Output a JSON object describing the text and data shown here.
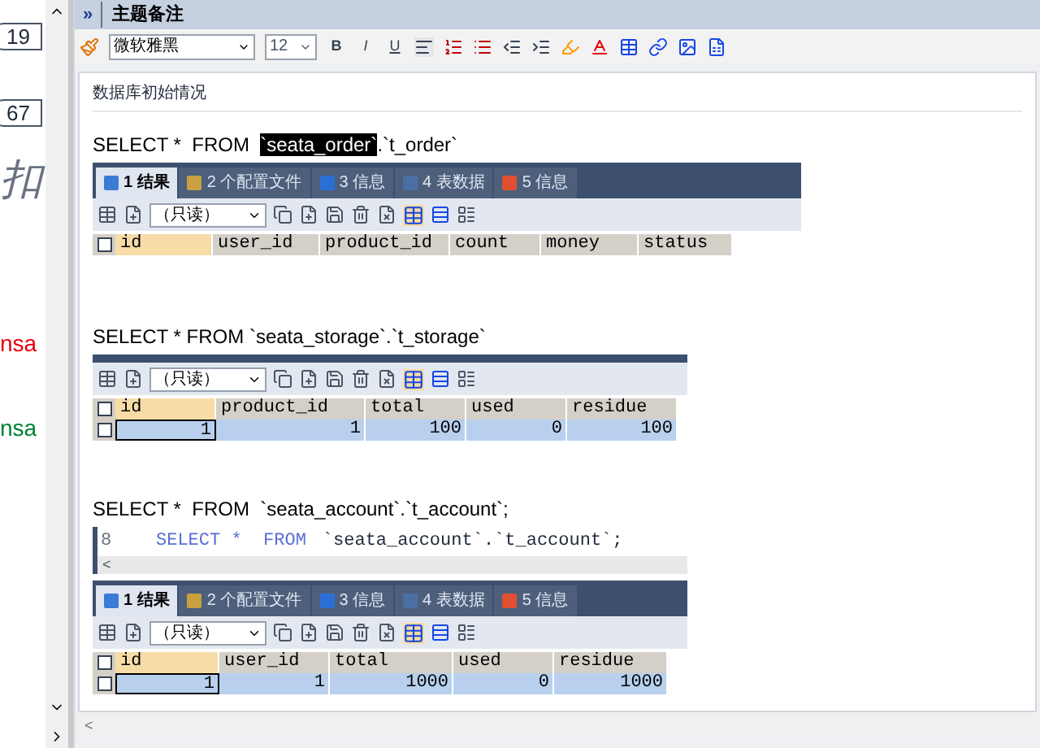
{
  "side_fragments": [
    {
      "kind": "badge",
      "text": "19"
    },
    {
      "kind": "badge",
      "text": "67"
    },
    {
      "kind": "glyph",
      "text": "扣"
    },
    {
      "kind": "red",
      "text": "nsa"
    },
    {
      "kind": "green",
      "text": "nsa"
    }
  ],
  "header": {
    "toggle": "»",
    "title": "主题备注"
  },
  "toolbar": {
    "font": "微软雅黑",
    "size": "12",
    "bold": "B",
    "italic": "I",
    "underline": "U"
  },
  "note_title": "数据库初始情况",
  "blocks": [
    {
      "query": [
        {
          "text": "SELECT *  FROM  ",
          "selected": false
        },
        {
          "text": "`seata_order`",
          "selected": true
        },
        {
          "text": ".`t_order`",
          "selected": false
        }
      ],
      "tabs": [
        {
          "label": "1 结果",
          "selected": true
        },
        {
          "label": "2 个配置文件",
          "selected": false
        },
        {
          "label": "3 信息",
          "selected": false
        },
        {
          "label": "4 表数据",
          "selected": false
        },
        {
          "label": "5 信息",
          "selected": false
        }
      ],
      "mode": "（只读）",
      "columns": [
        {
          "label": "id",
          "selected": true
        },
        {
          "label": "user_id",
          "selected": false
        },
        {
          "label": "product_id",
          "selected": false
        },
        {
          "label": "count",
          "selected": false
        },
        {
          "label": "money",
          "selected": false
        },
        {
          "label": "status",
          "selected": false
        }
      ],
      "select_all_checked": false
    },
    {
      "query": [
        {
          "text": "SELECT * FROM `seata_storage`.`t_storage`",
          "selected": false
        }
      ],
      "mode": "（只读）",
      "columns": [
        {
          "label": "id",
          "selected": true
        },
        {
          "label": "product_id",
          "selected": false
        },
        {
          "label": "total",
          "selected": false
        },
        {
          "label": "used",
          "selected": false
        },
        {
          "label": "residue",
          "selected": false
        }
      ],
      "select_all_checked": false,
      "rows": [
        {
          "checked": false,
          "cells": [
            "1",
            "1",
            "100",
            "0",
            "100"
          ]
        }
      ]
    },
    {
      "query": [
        {
          "text": "SELECT *  FROM  `seata_account`.`t_account`;",
          "selected": false
        }
      ],
      "editor": {
        "line_number": "8",
        "code": [
          {
            "kind": "keyword",
            "text": "SELECT *  FROM"
          },
          {
            "kind": "plain",
            "text": "`seata_account`.`t_account`;"
          }
        ],
        "scroll_left": "<"
      },
      "tabs": [
        {
          "label": "1 结果",
          "selected": true
        },
        {
          "label": "2 个配置文件",
          "selected": false
        },
        {
          "label": "3 信息",
          "selected": false
        },
        {
          "label": "4 表数据",
          "selected": false
        },
        {
          "label": "5 信息",
          "selected": false
        }
      ],
      "mode": "（只读）",
      "columns": [
        {
          "label": "id",
          "selected": true
        },
        {
          "label": "user_id",
          "selected": false
        },
        {
          "label": "total",
          "selected": false
        },
        {
          "label": "used",
          "selected": false
        },
        {
          "label": "residue",
          "selected": false
        }
      ],
      "select_all_checked": false,
      "rows": [
        {
          "checked": false,
          "cells": [
            "1",
            "1",
            "1000",
            "0",
            "1000"
          ]
        }
      ]
    }
  ],
  "bottom_scroll": "<"
}
